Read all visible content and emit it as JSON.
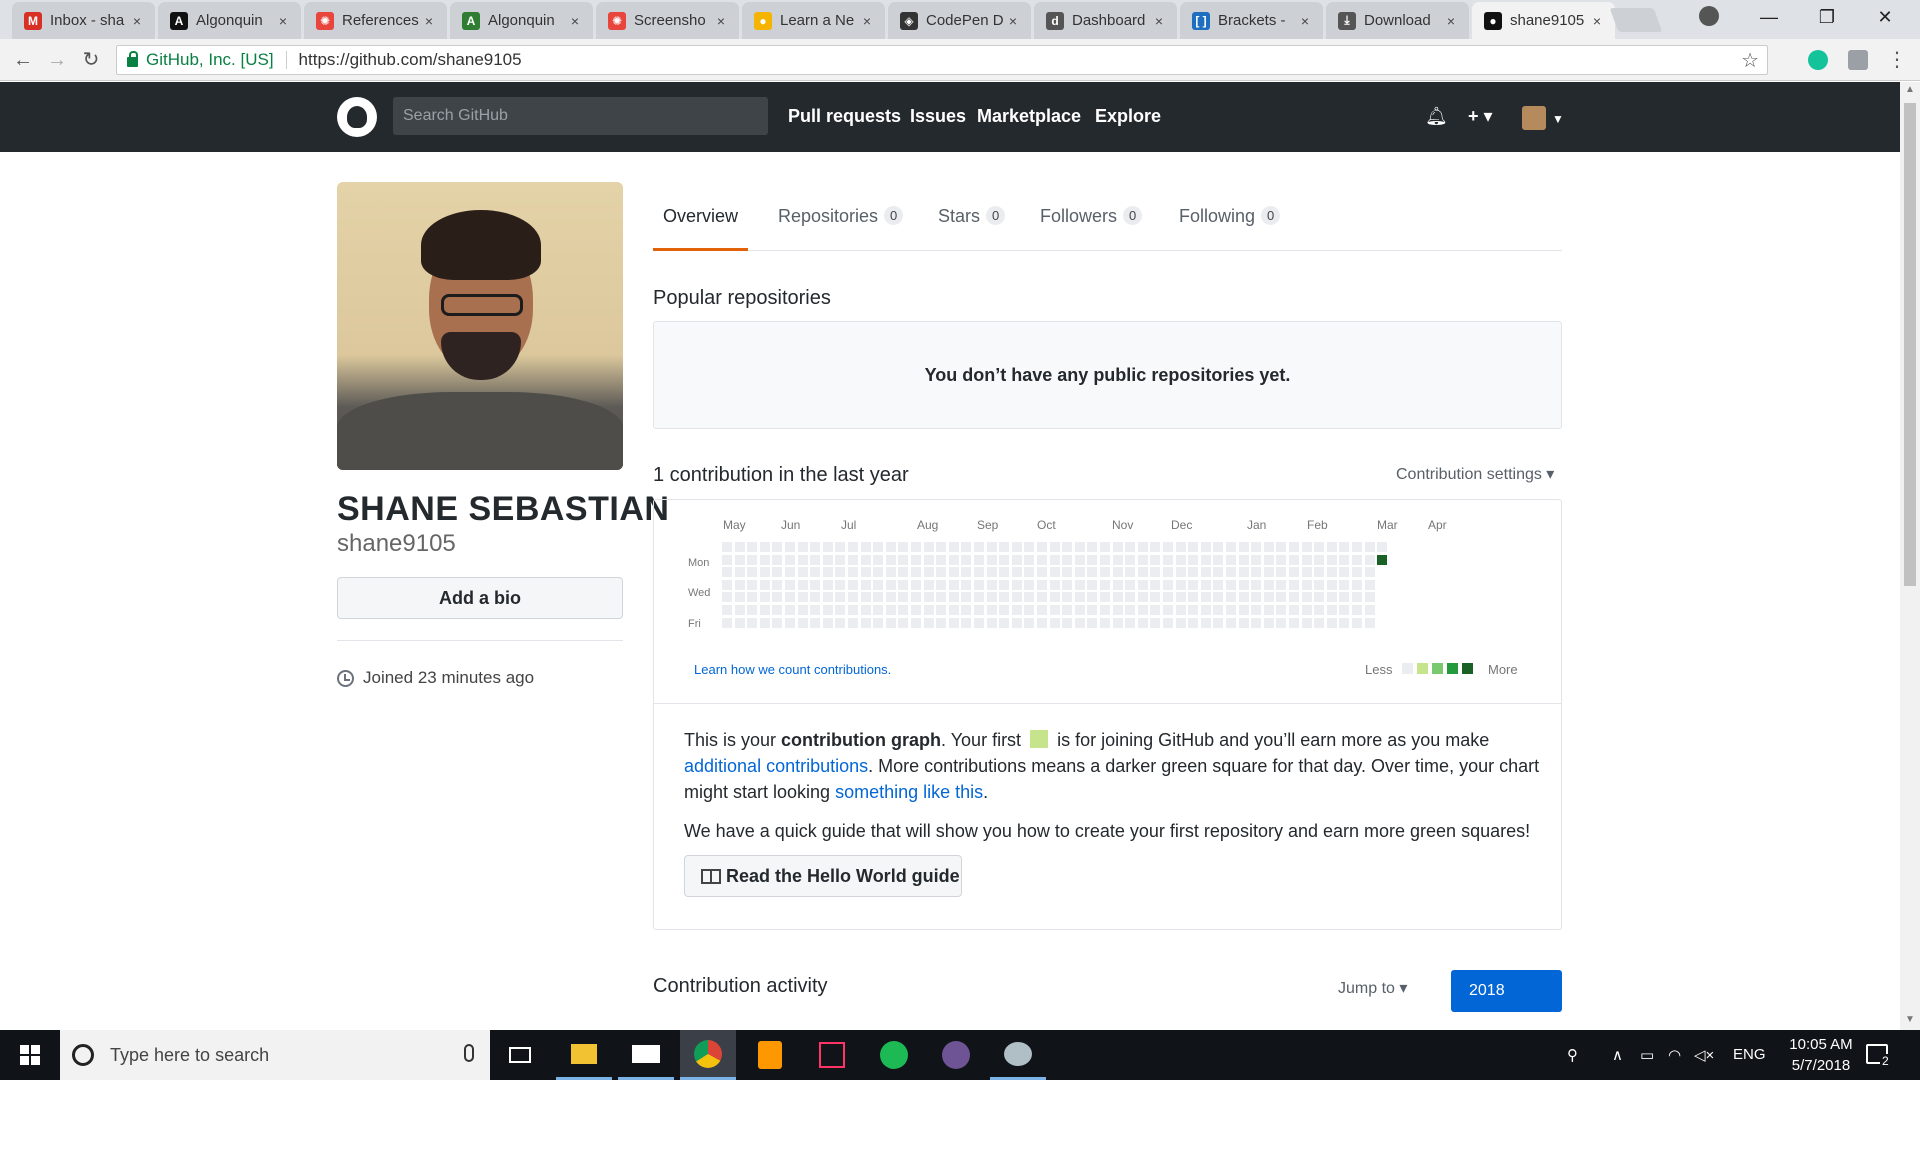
{
  "browser": {
    "tabs": [
      {
        "title": "Inbox - sha",
        "favicon_color": "#d93025",
        "favicon_glyph": "M"
      },
      {
        "title": "Algonquin",
        "favicon_color": "#111111",
        "favicon_glyph": "A"
      },
      {
        "title": "References",
        "favicon_color": "#e8453c",
        "favicon_glyph": "✺"
      },
      {
        "title": "Algonquin",
        "favicon_color": "#2e7d32",
        "favicon_glyph": "A"
      },
      {
        "title": "Screensho",
        "favicon_color": "#e8453c",
        "favicon_glyph": "✺"
      },
      {
        "title": "Learn a Ne",
        "favicon_color": "#f4b400",
        "favicon_glyph": "●"
      },
      {
        "title": "CodePen D",
        "favicon_color": "#333333",
        "favicon_glyph": "◈"
      },
      {
        "title": "Dashboard",
        "favicon_color": "#555555",
        "favicon_glyph": "d"
      },
      {
        "title": "Brackets -",
        "favicon_color": "#1e6fbf",
        "favicon_glyph": "[ ]"
      },
      {
        "title": "Download",
        "favicon_color": "#555555",
        "favicon_glyph": "⤓"
      },
      {
        "title": "shane9105",
        "favicon_color": "#111111",
        "favicon_glyph": "●"
      }
    ],
    "tab_close_glyph": "×",
    "secure_label": "GitHub, Inc. [US]",
    "url": "https://github.com/shane9105"
  },
  "github_header": {
    "search_placeholder": "Search GitHub",
    "nav": [
      "Pull requests",
      "Issues",
      "Marketplace",
      "Explore"
    ]
  },
  "profile": {
    "name": "SHANE SEBASTIAN",
    "username": "shane9105",
    "bio_button": "Add a bio",
    "joined": "Joined 23 minutes ago"
  },
  "tabs": [
    {
      "label": "Overview",
      "count": null
    },
    {
      "label": "Repositories",
      "count": "0"
    },
    {
      "label": "Stars",
      "count": "0"
    },
    {
      "label": "Followers",
      "count": "0"
    },
    {
      "label": "Following",
      "count": "0"
    }
  ],
  "popular": {
    "title": "Popular repositories",
    "empty_message": "You don’t have any public repositories yet."
  },
  "contributions": {
    "title": "1 contribution in the last year",
    "settings": "Contribution settings ▾",
    "months": [
      "May",
      "Jun",
      "Jul",
      "Aug",
      "Sep",
      "Oct",
      "Nov",
      "Dec",
      "Jan",
      "Feb",
      "Mar",
      "Apr"
    ],
    "day_labels": [
      "Mon",
      "Wed",
      "Fri"
    ],
    "weeks": 53,
    "filled_week": 52,
    "filled_day": 1,
    "learn_link": "Learn how we count contributions.",
    "legend_less": "Less",
    "legend_more": "More",
    "colors": {
      "empty": "#ebedf0",
      "l1": "#c6e48b",
      "l2": "#7bc96f",
      "l3": "#239a3b",
      "l4": "#196127"
    }
  },
  "info": {
    "p1_a": "This is your ",
    "p1_bold": "contribution graph",
    "p1_b": ". Your first",
    "p1_c": "is for joining GitHub and you’ll earn more as you make",
    "p1_link1": "additional contributions",
    "p1_d": ". More contributions means a darker green square for that day. Over time, your chart might start looking",
    "p1_link2": "something like this",
    "p1_e": ".",
    "p2": "We have a quick guide that will show you how to create your first repository and earn more green squares!",
    "guide_button": "Read the Hello World guide"
  },
  "activity": {
    "title": "Contribution activity",
    "jump": "Jump to ▾",
    "year": "2018"
  },
  "taskbar": {
    "search_placeholder": "Type here to search",
    "language": "ENG",
    "time": "10:05 AM",
    "date": "5/7/2018",
    "notification_count": "2"
  }
}
